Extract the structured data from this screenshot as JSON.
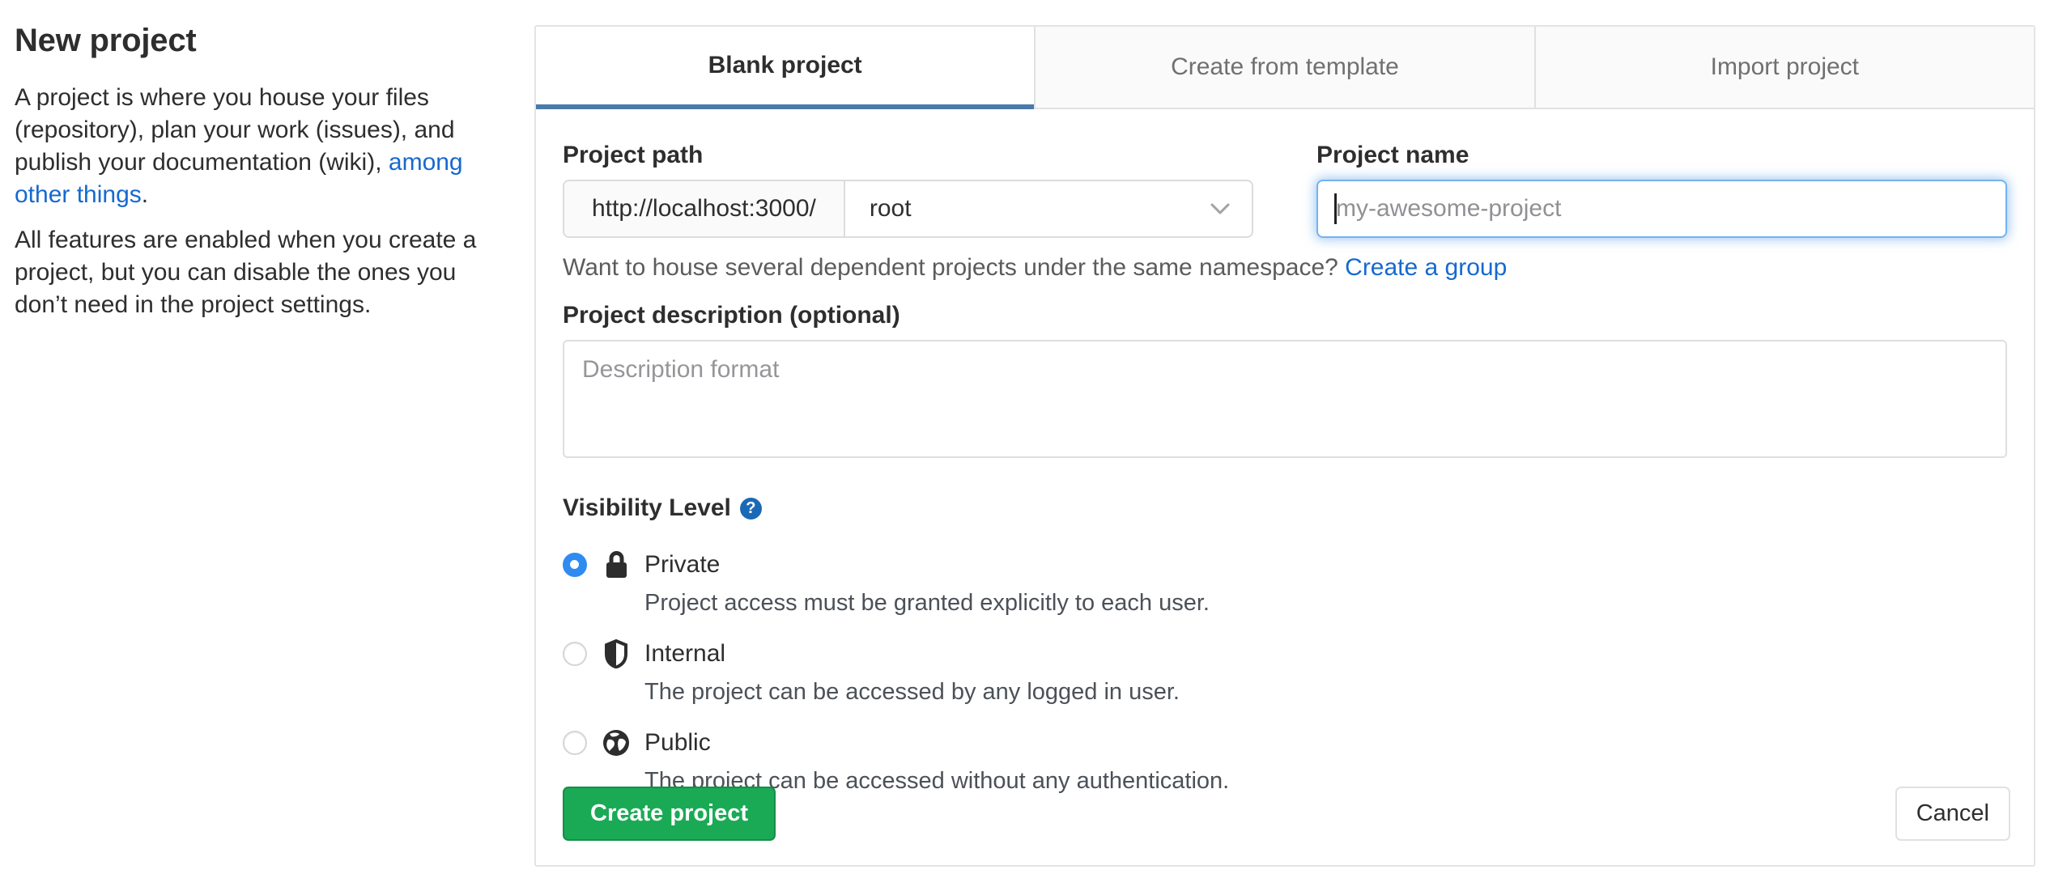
{
  "sidebar": {
    "heading": "New project",
    "para1_before_link": "A project is where you house your files\n(repository), plan your work (issues), and\npublish your documentation (wiki), ",
    "para1_link": "among\nother things",
    "para1_after_link": ".",
    "para2": "All features are enabled when you create a\nproject, but you can disable the ones you\ndon’t need in the project settings."
  },
  "tabs": [
    {
      "label": "Blank project",
      "active": true
    },
    {
      "label": "Create from template",
      "active": false
    },
    {
      "label": "Import project",
      "active": false
    }
  ],
  "form": {
    "project_path": {
      "label": "Project path",
      "url_prefix": "http://localhost:3000/",
      "namespace_selected": "root"
    },
    "project_name": {
      "label": "Project name",
      "value": "",
      "placeholder": "my-awesome-project"
    },
    "namespace_hint": {
      "text": "Want to house several dependent projects under the same namespace? ",
      "link": "Create a group"
    },
    "description": {
      "label": "Project description (optional)",
      "placeholder": "Description format",
      "value": ""
    },
    "visibility": {
      "label": "Visibility Level",
      "help_icon": "question-mark-icon",
      "options": [
        {
          "name": "Private",
          "icon": "lock-icon",
          "selected": true,
          "description": "Project access must be granted explicitly to each user."
        },
        {
          "name": "Internal",
          "icon": "shield-icon",
          "selected": false,
          "description": "The project can be accessed by any logged in user."
        },
        {
          "name": "Public",
          "icon": "globe-icon",
          "selected": false,
          "description": "The project can be accessed without any authentication."
        }
      ]
    },
    "submit_label": "Create project",
    "cancel_label": "Cancel"
  },
  "colors": {
    "tab_active_indicator": "#4a79ac",
    "link_blue": "#1669cf",
    "primary_button_green": "#1aaa55",
    "radio_selected_blue": "#2f8bf0",
    "help_icon_blue": "#1b69b6",
    "focused_input_border": "#74b2f1",
    "panel_border": "#e4e4e4",
    "inactive_tab_bg": "#fafafa"
  }
}
